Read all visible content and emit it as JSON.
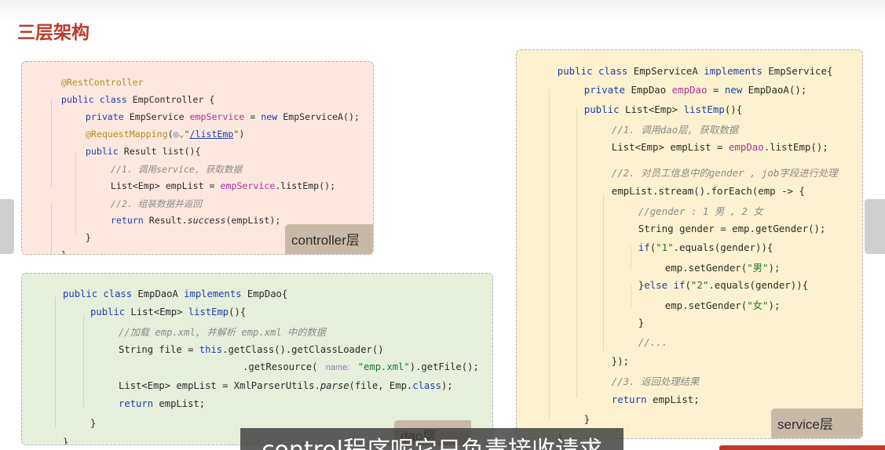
{
  "slide": {
    "title": "三层架构"
  },
  "controller": {
    "tag": "controller层",
    "lines": [
      [
        "@RestController"
      ],
      [
        "public class",
        " EmpController {"
      ],
      [
        "private",
        " EmpService ",
        "empService",
        " = ",
        "new",
        " EmpServiceA();"
      ],
      [
        "@RequestMapping",
        "(",
        "name:",
        "\"",
        "/listEmp",
        "\")"
      ],
      [
        "public",
        " Result list(){"
      ],
      [
        "//1. 调用service, 获取数据"
      ],
      [
        "List<Emp> empList = ",
        "empService",
        ".listEmp();"
      ],
      [
        "//2. 组装数据并返回"
      ],
      [
        "return",
        " Result.",
        "success",
        "(empList);"
      ],
      [
        "}"
      ],
      [
        "}"
      ]
    ]
  },
  "dao": {
    "tag": "dao层",
    "lines": [
      [
        "public class",
        " EmpDaoA ",
        "implements",
        " EmpDao{"
      ],
      [
        "public",
        " List<Emp> ",
        "listEmp",
        "(){"
      ],
      [
        "//加载 emp.xml, 并解析 emp.xml 中的数据"
      ],
      [
        "String file = ",
        "this",
        ".getClass().getClassLoader()"
      ],
      [
        ".getResource(",
        "name:",
        "\"emp.xml\"",
        ").getFile();"
      ],
      [
        "List<Emp> empList = XmlParserUtils.",
        "parse",
        "(file, Emp.",
        "class",
        ");"
      ],
      [
        "return",
        " empList;"
      ],
      [
        "}"
      ],
      [
        "}"
      ]
    ]
  },
  "service": {
    "tag": "service层",
    "lines": [
      [
        "public class",
        " EmpServiceA ",
        "implements",
        " EmpService{"
      ],
      [
        "private",
        " EmpDao ",
        "empDao",
        " = ",
        "new",
        " EmpDaoA();"
      ],
      [
        "public",
        " List<Emp> ",
        "listEmp",
        "(){"
      ],
      [
        "//1. 调用dao层, 获取数据"
      ],
      [
        "List<Emp> empList = ",
        "empDao",
        ".listEmp();"
      ],
      [
        "//2. 对员工信息中的gender , job字段进行处理"
      ],
      [
        "empList.stream().forEach(emp -> {"
      ],
      [
        "//gender : 1 男 , 2 女"
      ],
      [
        "String gender = emp.getGender();"
      ],
      [
        "if",
        "(",
        "\"1\"",
        ".equals(gender)){"
      ],
      [
        "emp.setGender(",
        "\"男\"",
        ");"
      ],
      [
        "}",
        "else if",
        "(",
        "\"2\"",
        ".equals(gender)){"
      ],
      [
        "emp.setGender(",
        "\"女\"",
        ");"
      ],
      [
        "}"
      ],
      [
        "//..."
      ],
      [
        "});"
      ],
      [
        "//3. 返回处理结果"
      ],
      [
        "return",
        " empList;"
      ],
      [
        "}"
      ],
      [
        "}"
      ]
    ]
  },
  "subtitle": "control程序呢它只负责接收请求",
  "colors": {
    "title": "#c0392b",
    "controller_bg": "#fde8e0",
    "dao_bg": "#e6efdc",
    "service_bg": "#fdf2cf",
    "keyword": "#1f3fa8",
    "field": "#b0329a",
    "string": "#1b7a2b",
    "annotation": "#b38b1a",
    "comment": "#8a8a8a"
  },
  "icons": {
    "mapping_hint": "globe-icon",
    "left_nav": "prev-slide-tab",
    "right_nav": "next-slide-tab"
  }
}
